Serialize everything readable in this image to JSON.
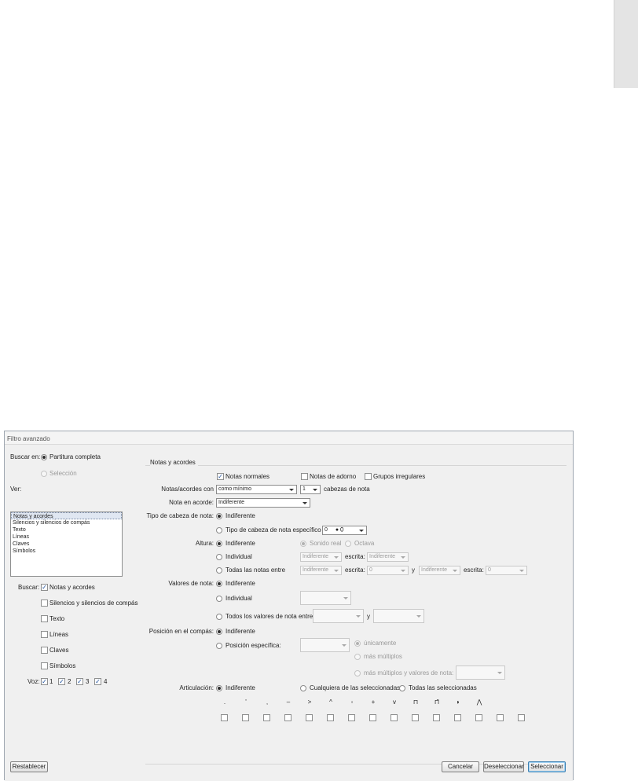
{
  "dialog": {
    "title": "Filtro avanzado",
    "search_in": {
      "label": "Buscar en:",
      "options": [
        "Partitura completa",
        "Selección"
      ],
      "selected": 0
    },
    "view": {
      "label": "Ver:",
      "items": [
        "Notas y acordes",
        "Silencios y silencios de compás",
        "Texto",
        "Líneas",
        "Claves",
        "Símbolos"
      ],
      "selected_index": 0
    },
    "find": {
      "label": "Buscar:",
      "items": [
        {
          "label": "Notas y acordes",
          "checked": true
        },
        {
          "label": "Silencios y silencios de compás",
          "checked": false
        },
        {
          "label": "Texto",
          "checked": false
        },
        {
          "label": "Líneas",
          "checked": false
        },
        {
          "label": "Claves",
          "checked": false
        },
        {
          "label": "Símbolos",
          "checked": false
        }
      ]
    },
    "voice": {
      "label": "Voz:",
      "items": [
        {
          "label": "1",
          "checked": true
        },
        {
          "label": "2",
          "checked": true
        },
        {
          "label": "3",
          "checked": true
        },
        {
          "label": "4",
          "checked": true
        }
      ]
    },
    "group_title": "Notas y acordes",
    "note_types": [
      {
        "label": "Notas normales",
        "checked": true
      },
      {
        "label": "Notas de adorno",
        "checked": false
      },
      {
        "label": "Grupos irregulares",
        "checked": false
      }
    ],
    "chords_with": {
      "label": "Notas/acordes con",
      "mode": "como mínimo",
      "count": "1",
      "suffix": "cabezas de nota"
    },
    "note_in_chord": {
      "label": "Nota en acorde:",
      "value": "Indiferente"
    },
    "notehead": {
      "label": "Tipo de cabeza de nota:",
      "opt_any": "Indiferente",
      "opt_specific": "Tipo de cabeza de nota específico",
      "specific_value": "0"
    },
    "pitch": {
      "label": "Altura:",
      "opt_any": "Indiferente",
      "sound_real": "Sonido real",
      "octave": "Octava",
      "opt_single": "Individual",
      "single_value": "Indiferente",
      "written_label": "escrita:",
      "single_written": "Indiferente",
      "opt_between": "Todas las notas entre",
      "between_from": "Indiferente",
      "between_from_written": "0",
      "and_label": "y",
      "between_to": "Indiferente",
      "between_to_written": "0"
    },
    "durations": {
      "label": "Valores de nota:",
      "opt_any": "Indiferente",
      "opt_single": "Individual",
      "opt_between": "Todos los valores de nota entre",
      "and_label": "y"
    },
    "position": {
      "label": "Posición en el compás:",
      "opt_any": "Indiferente",
      "opt_specific": "Posición específica:",
      "only": "únicamente",
      "multiples": "más múltiplos",
      "multiples_values": "más múltiplos y valores de nota:"
    },
    "articulation": {
      "label": "Articulación:",
      "opt_any": "Indiferente",
      "opt_any_selected": "Cualquiera de las seleccionadas",
      "opt_all_selected": "Todas las seleccionadas",
      "symbols": [
        ".",
        "'",
        "‚",
        "–",
        ">",
        "^",
        "◦",
        "+",
        "v",
        "⊓",
        "⊓̄",
        "◗",
        "⋀",
        "",
        ""
      ]
    },
    "buttons": {
      "reset": "Restablecer",
      "cancel": "Cancelar",
      "deselect": "Deseleccionar",
      "select": "Seleccionar"
    }
  }
}
